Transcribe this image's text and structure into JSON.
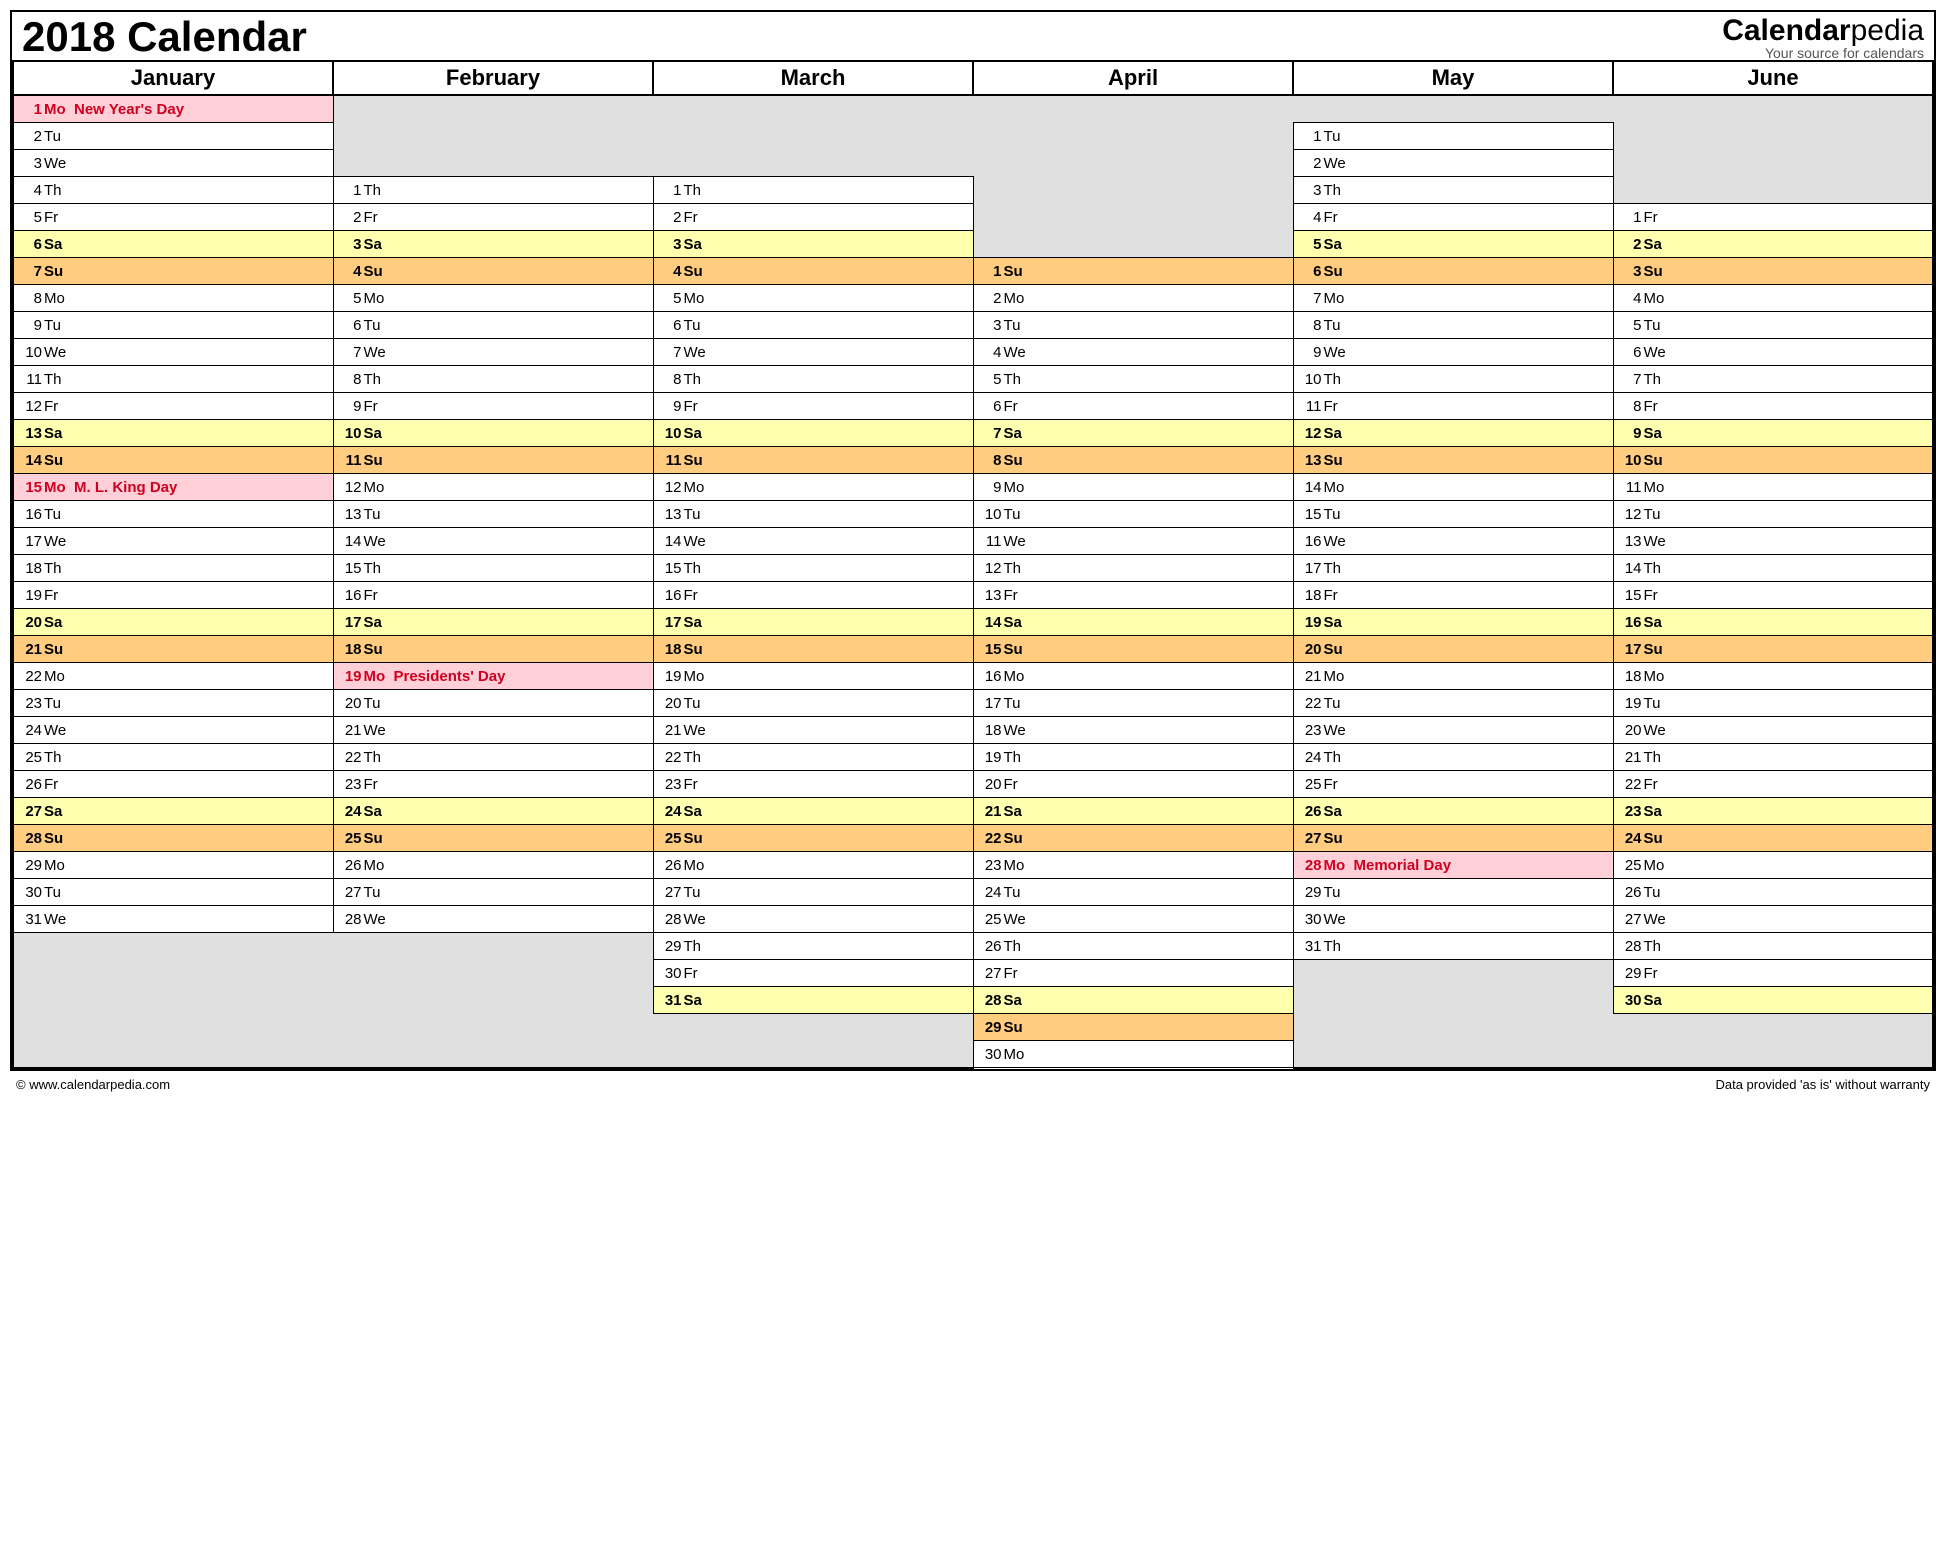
{
  "title": "2018 Calendar",
  "brand": {
    "main_bold": "Calendar",
    "main_rest": "pedia",
    "sub": "Your source for calendars"
  },
  "footer": {
    "left": "© www.calendarpedia.com",
    "right": "Data provided 'as is' without warranty"
  },
  "months": [
    "January",
    "February",
    "March",
    "April",
    "May",
    "June"
  ],
  "rows": [
    [
      {
        "d": 1,
        "w": "Mo",
        "t": "New Year's Day",
        "hol": true
      },
      null,
      null,
      null,
      null,
      null
    ],
    [
      {
        "d": 2,
        "w": "Tu"
      },
      null,
      null,
      null,
      {
        "d": 1,
        "w": "Tu"
      },
      null
    ],
    [
      {
        "d": 3,
        "w": "We"
      },
      null,
      null,
      null,
      {
        "d": 2,
        "w": "We"
      },
      null
    ],
    [
      {
        "d": 4,
        "w": "Th"
      },
      {
        "d": 1,
        "w": "Th"
      },
      {
        "d": 1,
        "w": "Th"
      },
      null,
      {
        "d": 3,
        "w": "Th"
      },
      null
    ],
    [
      {
        "d": 5,
        "w": "Fr"
      },
      {
        "d": 2,
        "w": "Fr"
      },
      {
        "d": 2,
        "w": "Fr"
      },
      null,
      {
        "d": 4,
        "w": "Fr"
      },
      {
        "d": 1,
        "w": "Fr"
      }
    ],
    [
      {
        "d": 6,
        "w": "Sa"
      },
      {
        "d": 3,
        "w": "Sa"
      },
      {
        "d": 3,
        "w": "Sa"
      },
      null,
      {
        "d": 5,
        "w": "Sa"
      },
      {
        "d": 2,
        "w": "Sa"
      }
    ],
    [
      {
        "d": 7,
        "w": "Su"
      },
      {
        "d": 4,
        "w": "Su"
      },
      {
        "d": 4,
        "w": "Su"
      },
      {
        "d": 1,
        "w": "Su"
      },
      {
        "d": 6,
        "w": "Su"
      },
      {
        "d": 3,
        "w": "Su"
      }
    ],
    [
      {
        "d": 8,
        "w": "Mo"
      },
      {
        "d": 5,
        "w": "Mo"
      },
      {
        "d": 5,
        "w": "Mo"
      },
      {
        "d": 2,
        "w": "Mo"
      },
      {
        "d": 7,
        "w": "Mo"
      },
      {
        "d": 4,
        "w": "Mo"
      }
    ],
    [
      {
        "d": 9,
        "w": "Tu"
      },
      {
        "d": 6,
        "w": "Tu"
      },
      {
        "d": 6,
        "w": "Tu"
      },
      {
        "d": 3,
        "w": "Tu"
      },
      {
        "d": 8,
        "w": "Tu"
      },
      {
        "d": 5,
        "w": "Tu"
      }
    ],
    [
      {
        "d": 10,
        "w": "We"
      },
      {
        "d": 7,
        "w": "We"
      },
      {
        "d": 7,
        "w": "We"
      },
      {
        "d": 4,
        "w": "We"
      },
      {
        "d": 9,
        "w": "We"
      },
      {
        "d": 6,
        "w": "We"
      }
    ],
    [
      {
        "d": 11,
        "w": "Th"
      },
      {
        "d": 8,
        "w": "Th"
      },
      {
        "d": 8,
        "w": "Th"
      },
      {
        "d": 5,
        "w": "Th"
      },
      {
        "d": 10,
        "w": "Th"
      },
      {
        "d": 7,
        "w": "Th"
      }
    ],
    [
      {
        "d": 12,
        "w": "Fr"
      },
      {
        "d": 9,
        "w": "Fr"
      },
      {
        "d": 9,
        "w": "Fr"
      },
      {
        "d": 6,
        "w": "Fr"
      },
      {
        "d": 11,
        "w": "Fr"
      },
      {
        "d": 8,
        "w": "Fr"
      }
    ],
    [
      {
        "d": 13,
        "w": "Sa"
      },
      {
        "d": 10,
        "w": "Sa"
      },
      {
        "d": 10,
        "w": "Sa"
      },
      {
        "d": 7,
        "w": "Sa"
      },
      {
        "d": 12,
        "w": "Sa"
      },
      {
        "d": 9,
        "w": "Sa"
      }
    ],
    [
      {
        "d": 14,
        "w": "Su"
      },
      {
        "d": 11,
        "w": "Su"
      },
      {
        "d": 11,
        "w": "Su"
      },
      {
        "d": 8,
        "w": "Su"
      },
      {
        "d": 13,
        "w": "Su"
      },
      {
        "d": 10,
        "w": "Su"
      }
    ],
    [
      {
        "d": 15,
        "w": "Mo",
        "t": "M. L. King Day",
        "hol": true
      },
      {
        "d": 12,
        "w": "Mo"
      },
      {
        "d": 12,
        "w": "Mo"
      },
      {
        "d": 9,
        "w": "Mo"
      },
      {
        "d": 14,
        "w": "Mo"
      },
      {
        "d": 11,
        "w": "Mo"
      }
    ],
    [
      {
        "d": 16,
        "w": "Tu"
      },
      {
        "d": 13,
        "w": "Tu"
      },
      {
        "d": 13,
        "w": "Tu"
      },
      {
        "d": 10,
        "w": "Tu"
      },
      {
        "d": 15,
        "w": "Tu"
      },
      {
        "d": 12,
        "w": "Tu"
      }
    ],
    [
      {
        "d": 17,
        "w": "We"
      },
      {
        "d": 14,
        "w": "We"
      },
      {
        "d": 14,
        "w": "We"
      },
      {
        "d": 11,
        "w": "We"
      },
      {
        "d": 16,
        "w": "We"
      },
      {
        "d": 13,
        "w": "We"
      }
    ],
    [
      {
        "d": 18,
        "w": "Th"
      },
      {
        "d": 15,
        "w": "Th"
      },
      {
        "d": 15,
        "w": "Th"
      },
      {
        "d": 12,
        "w": "Th"
      },
      {
        "d": 17,
        "w": "Th"
      },
      {
        "d": 14,
        "w": "Th"
      }
    ],
    [
      {
        "d": 19,
        "w": "Fr"
      },
      {
        "d": 16,
        "w": "Fr"
      },
      {
        "d": 16,
        "w": "Fr"
      },
      {
        "d": 13,
        "w": "Fr"
      },
      {
        "d": 18,
        "w": "Fr"
      },
      {
        "d": 15,
        "w": "Fr"
      }
    ],
    [
      {
        "d": 20,
        "w": "Sa"
      },
      {
        "d": 17,
        "w": "Sa"
      },
      {
        "d": 17,
        "w": "Sa"
      },
      {
        "d": 14,
        "w": "Sa"
      },
      {
        "d": 19,
        "w": "Sa"
      },
      {
        "d": 16,
        "w": "Sa"
      }
    ],
    [
      {
        "d": 21,
        "w": "Su"
      },
      {
        "d": 18,
        "w": "Su"
      },
      {
        "d": 18,
        "w": "Su"
      },
      {
        "d": 15,
        "w": "Su"
      },
      {
        "d": 20,
        "w": "Su"
      },
      {
        "d": 17,
        "w": "Su"
      }
    ],
    [
      {
        "d": 22,
        "w": "Mo"
      },
      {
        "d": 19,
        "w": "Mo",
        "t": "Presidents' Day",
        "hol": true
      },
      {
        "d": 19,
        "w": "Mo"
      },
      {
        "d": 16,
        "w": "Mo"
      },
      {
        "d": 21,
        "w": "Mo"
      },
      {
        "d": 18,
        "w": "Mo"
      }
    ],
    [
      {
        "d": 23,
        "w": "Tu"
      },
      {
        "d": 20,
        "w": "Tu"
      },
      {
        "d": 20,
        "w": "Tu"
      },
      {
        "d": 17,
        "w": "Tu"
      },
      {
        "d": 22,
        "w": "Tu"
      },
      {
        "d": 19,
        "w": "Tu"
      }
    ],
    [
      {
        "d": 24,
        "w": "We"
      },
      {
        "d": 21,
        "w": "We"
      },
      {
        "d": 21,
        "w": "We"
      },
      {
        "d": 18,
        "w": "We"
      },
      {
        "d": 23,
        "w": "We"
      },
      {
        "d": 20,
        "w": "We"
      }
    ],
    [
      {
        "d": 25,
        "w": "Th"
      },
      {
        "d": 22,
        "w": "Th"
      },
      {
        "d": 22,
        "w": "Th"
      },
      {
        "d": 19,
        "w": "Th"
      },
      {
        "d": 24,
        "w": "Th"
      },
      {
        "d": 21,
        "w": "Th"
      }
    ],
    [
      {
        "d": 26,
        "w": "Fr"
      },
      {
        "d": 23,
        "w": "Fr"
      },
      {
        "d": 23,
        "w": "Fr"
      },
      {
        "d": 20,
        "w": "Fr"
      },
      {
        "d": 25,
        "w": "Fr"
      },
      {
        "d": 22,
        "w": "Fr"
      }
    ],
    [
      {
        "d": 27,
        "w": "Sa"
      },
      {
        "d": 24,
        "w": "Sa"
      },
      {
        "d": 24,
        "w": "Sa"
      },
      {
        "d": 21,
        "w": "Sa"
      },
      {
        "d": 26,
        "w": "Sa"
      },
      {
        "d": 23,
        "w": "Sa"
      }
    ],
    [
      {
        "d": 28,
        "w": "Su"
      },
      {
        "d": 25,
        "w": "Su"
      },
      {
        "d": 25,
        "w": "Su"
      },
      {
        "d": 22,
        "w": "Su"
      },
      {
        "d": 27,
        "w": "Su"
      },
      {
        "d": 24,
        "w": "Su"
      }
    ],
    [
      {
        "d": 29,
        "w": "Mo"
      },
      {
        "d": 26,
        "w": "Mo"
      },
      {
        "d": 26,
        "w": "Mo"
      },
      {
        "d": 23,
        "w": "Mo"
      },
      {
        "d": 28,
        "w": "Mo",
        "t": "Memorial Day",
        "hol": true
      },
      {
        "d": 25,
        "w": "Mo"
      }
    ],
    [
      {
        "d": 30,
        "w": "Tu"
      },
      {
        "d": 27,
        "w": "Tu"
      },
      {
        "d": 27,
        "w": "Tu"
      },
      {
        "d": 24,
        "w": "Tu"
      },
      {
        "d": 29,
        "w": "Tu"
      },
      {
        "d": 26,
        "w": "Tu"
      }
    ],
    [
      {
        "d": 31,
        "w": "We"
      },
      {
        "d": 28,
        "w": "We"
      },
      {
        "d": 28,
        "w": "We"
      },
      {
        "d": 25,
        "w": "We"
      },
      {
        "d": 30,
        "w": "We"
      },
      {
        "d": 27,
        "w": "We"
      }
    ],
    [
      null,
      null,
      {
        "d": 29,
        "w": "Th"
      },
      {
        "d": 26,
        "w": "Th"
      },
      {
        "d": 31,
        "w": "Th"
      },
      {
        "d": 28,
        "w": "Th"
      }
    ],
    [
      null,
      null,
      {
        "d": 30,
        "w": "Fr"
      },
      {
        "d": 27,
        "w": "Fr"
      },
      null,
      {
        "d": 29,
        "w": "Fr"
      }
    ],
    [
      null,
      null,
      {
        "d": 31,
        "w": "Sa"
      },
      {
        "d": 28,
        "w": "Sa"
      },
      null,
      {
        "d": 30,
        "w": "Sa"
      }
    ],
    [
      null,
      null,
      null,
      {
        "d": 29,
        "w": "Su"
      },
      null,
      null
    ],
    [
      null,
      null,
      null,
      {
        "d": 30,
        "w": "Mo"
      },
      null,
      null
    ]
  ]
}
